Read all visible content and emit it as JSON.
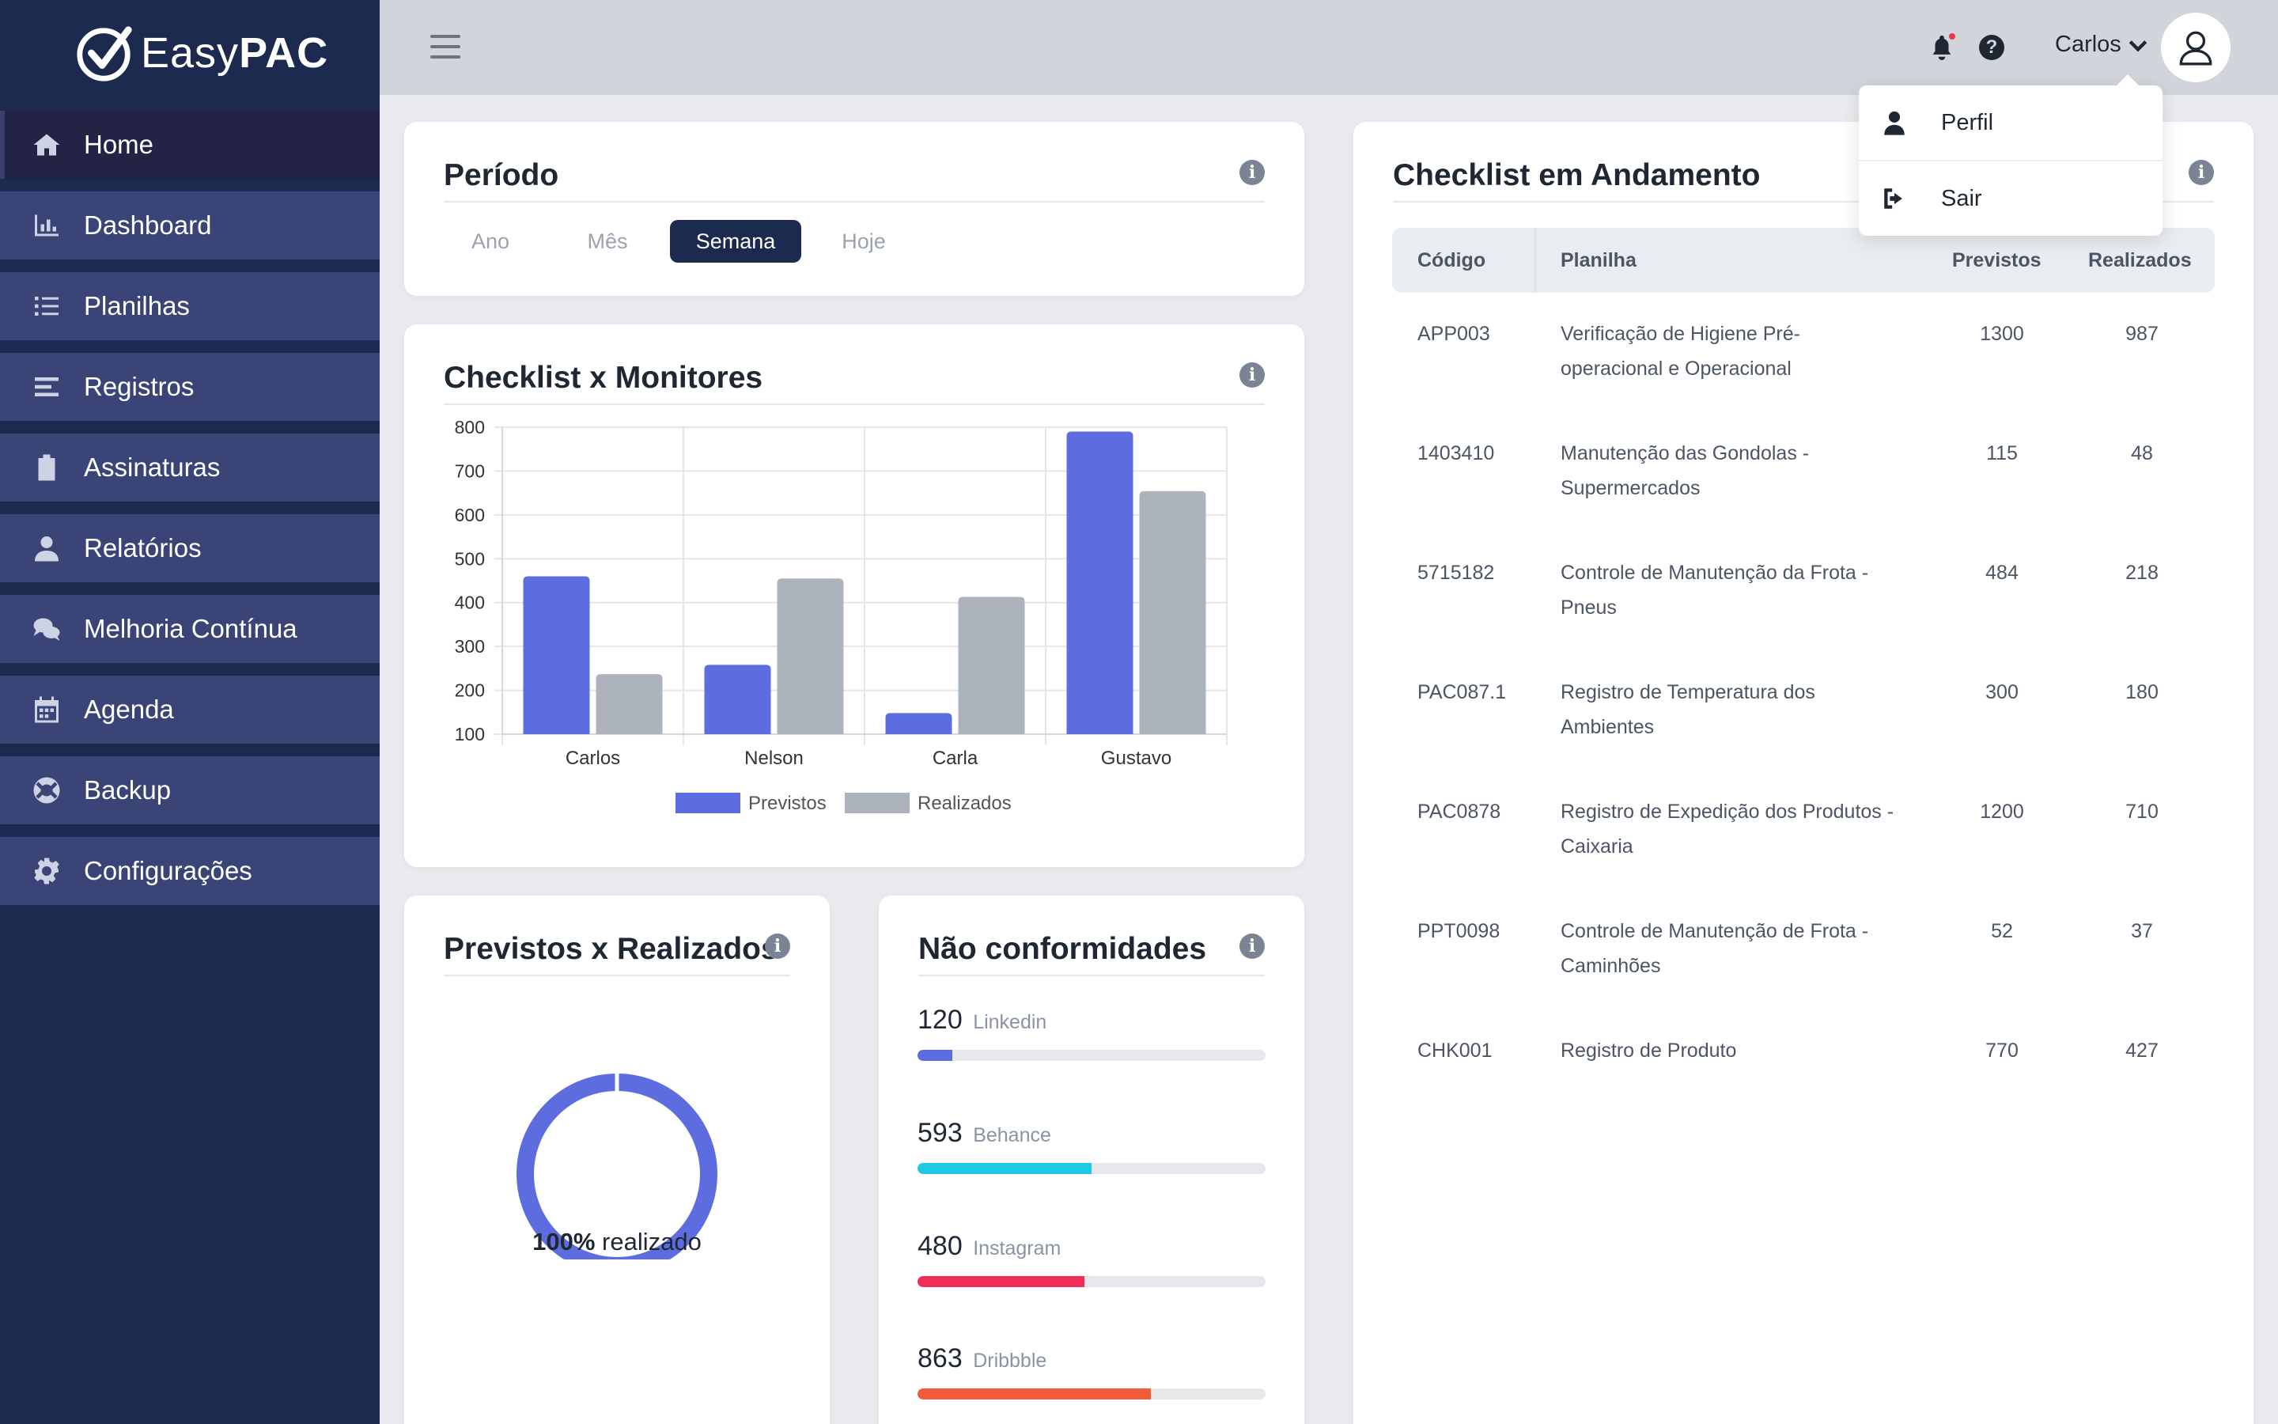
{
  "app": {
    "logo_text_light": "Easy",
    "logo_text_bold": "PAC"
  },
  "sidebar": {
    "items": [
      {
        "label": "Home",
        "icon": "home-icon"
      },
      {
        "label": "Dashboard",
        "icon": "bar-chart-icon"
      },
      {
        "label": "Planilhas",
        "icon": "list-icon"
      },
      {
        "label": "Registros",
        "icon": "lines-icon"
      },
      {
        "label": "Assinaturas",
        "icon": "clipboard-icon"
      },
      {
        "label": "Relatórios",
        "icon": "user-icon"
      },
      {
        "label": "Melhoria Contínua",
        "icon": "comments-icon"
      },
      {
        "label": "Agenda",
        "icon": "calendar-icon"
      },
      {
        "label": "Backup",
        "icon": "lifebuoy-icon"
      },
      {
        "label": "Configurações",
        "icon": "gear-icon"
      }
    ],
    "active_index": 0
  },
  "topbar": {
    "user_name": "Carlos",
    "notification_dot_color": "#e53946"
  },
  "dropdown": {
    "items": [
      {
        "label": "Perfil",
        "icon": "user-icon"
      },
      {
        "label": "Sair",
        "icon": "sign-out-icon"
      }
    ]
  },
  "periodo": {
    "title": "Período",
    "tabs": [
      "Ano",
      "Mês",
      "Semana",
      "Hoje"
    ],
    "active": "Semana"
  },
  "checklist_monitores": {
    "title": "Checklist x Monitores"
  },
  "chart_data": {
    "type": "bar",
    "categories": [
      "Carlos",
      "Nelson",
      "Carla",
      "Gustavo"
    ],
    "series": [
      {
        "name": "Previstos",
        "color": "#5d6de0",
        "values": [
          460,
          258,
          148,
          790
        ]
      },
      {
        "name": "Realizados",
        "color": "#adb3bc",
        "values": [
          237,
          455,
          413,
          654
        ]
      }
    ],
    "ylim": [
      100,
      800
    ],
    "yticks": [
      100,
      200,
      300,
      400,
      500,
      600,
      700,
      800
    ],
    "grid": true,
    "legend": "bottom",
    "xlabel": "",
    "ylabel": ""
  },
  "previstos_realizados": {
    "title": "Previstos x Realizados",
    "percent": "100%",
    "suffix": "realizado",
    "progress": 1.0,
    "color": "#5d6de0"
  },
  "nao_conformidades": {
    "title": "Não conformidades",
    "items": [
      {
        "value": "120",
        "source": "Linkedin",
        "fraction": 0.1,
        "color": "#5d6de0"
      },
      {
        "value": "593",
        "source": "Behance",
        "fraction": 0.5,
        "color": "#1fc8e3"
      },
      {
        "value": "480",
        "source": "Instagram",
        "fraction": 0.48,
        "color": "#ef2d56"
      },
      {
        "value": "863",
        "source": "Dribbble",
        "fraction": 0.67,
        "color": "#f25c3a"
      }
    ]
  },
  "checklist_andamento": {
    "title": "Checklist em Andamento",
    "columns": [
      "Código",
      "Planilha",
      "Previstos",
      "Realizados"
    ],
    "rows": [
      {
        "codigo": "APP003",
        "planilha_1": "Verificação de Higiene Pré-",
        "planilha_2": "operacional e Operacional",
        "previstos": "1300",
        "realizados": "987"
      },
      {
        "codigo": "1403410",
        "planilha_1": "Manutenção das Gondolas -",
        "planilha_2": "Supermercados",
        "previstos": "115",
        "realizados": "48"
      },
      {
        "codigo": "5715182",
        "planilha_1": "Controle de Manutenção da Frota -",
        "planilha_2": "Pneus",
        "previstos": "484",
        "realizados": "218"
      },
      {
        "codigo": "PAC087.1",
        "planilha_1": "Registro de Temperatura dos",
        "planilha_2": "Ambientes",
        "previstos": "300",
        "realizados": "180"
      },
      {
        "codigo": "PAC0878",
        "planilha_1": "Registro de Expedição dos Produtos -",
        "planilha_2": "Caixaria",
        "previstos": "1200",
        "realizados": "710"
      },
      {
        "codigo": "PPT0098",
        "planilha_1": "Controle de Manutenção de Frota -",
        "planilha_2": "Caminhões",
        "previstos": "52",
        "realizados": "37"
      },
      {
        "codigo": "CHK001",
        "planilha_1": "Registro de Produto",
        "planilha_2": "",
        "previstos": "770",
        "realizados": "427"
      }
    ]
  }
}
